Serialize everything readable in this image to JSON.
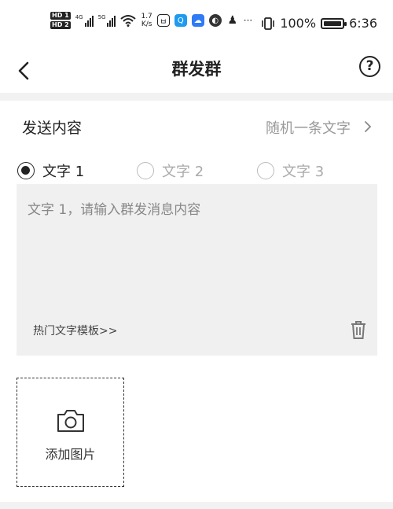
{
  "status_bar": {
    "network_4g": "4G",
    "network_5g": "5G",
    "hd1": "HD 1",
    "hd2": "HD 2",
    "speed_value": "1.7",
    "speed_unit": "K/s",
    "battery_percent": "100%",
    "battery_level": 1.0,
    "time": "6:36",
    "more": "···"
  },
  "header": {
    "title": "群发群",
    "help_symbol": "?"
  },
  "send_row": {
    "label": "发送内容",
    "value": "随机一条文字"
  },
  "radios": [
    {
      "label": "文字 1",
      "checked": true
    },
    {
      "label": "文字 2",
      "checked": false
    },
    {
      "label": "文字 3",
      "checked": false
    }
  ],
  "message": {
    "placeholder": "文字 1，请输入群发消息内容",
    "templates_link": "热门文字模板>>"
  },
  "add_image": {
    "label": "添加图片"
  },
  "colors": {
    "divider": "#f2f2f2",
    "textbox_bg": "#f0f0f0",
    "muted_text": "#999999"
  }
}
